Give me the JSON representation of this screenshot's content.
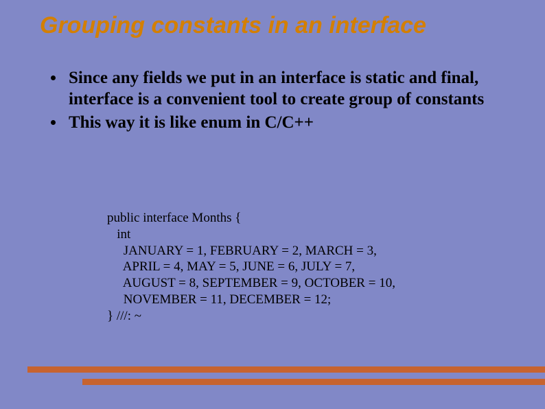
{
  "title": "Grouping constants in an interface",
  "bullets": [
    "Since any fields we put in an interface is static and final, interface is a convenient tool to create group of constants",
    "This way it is like enum in C/C++"
  ],
  "code": "public interface Months {\n   int\n     JANUARY = 1, FEBRUARY = 2, MARCH = 3,\n     APRIL = 4, MAY = 5, JUNE = 6, JULY = 7,\n     AUGUST = 8, SEPTEMBER = 9, OCTOBER = 10,\n     NOVEMBER = 11, DECEMBER = 12;\n} ///: ~"
}
